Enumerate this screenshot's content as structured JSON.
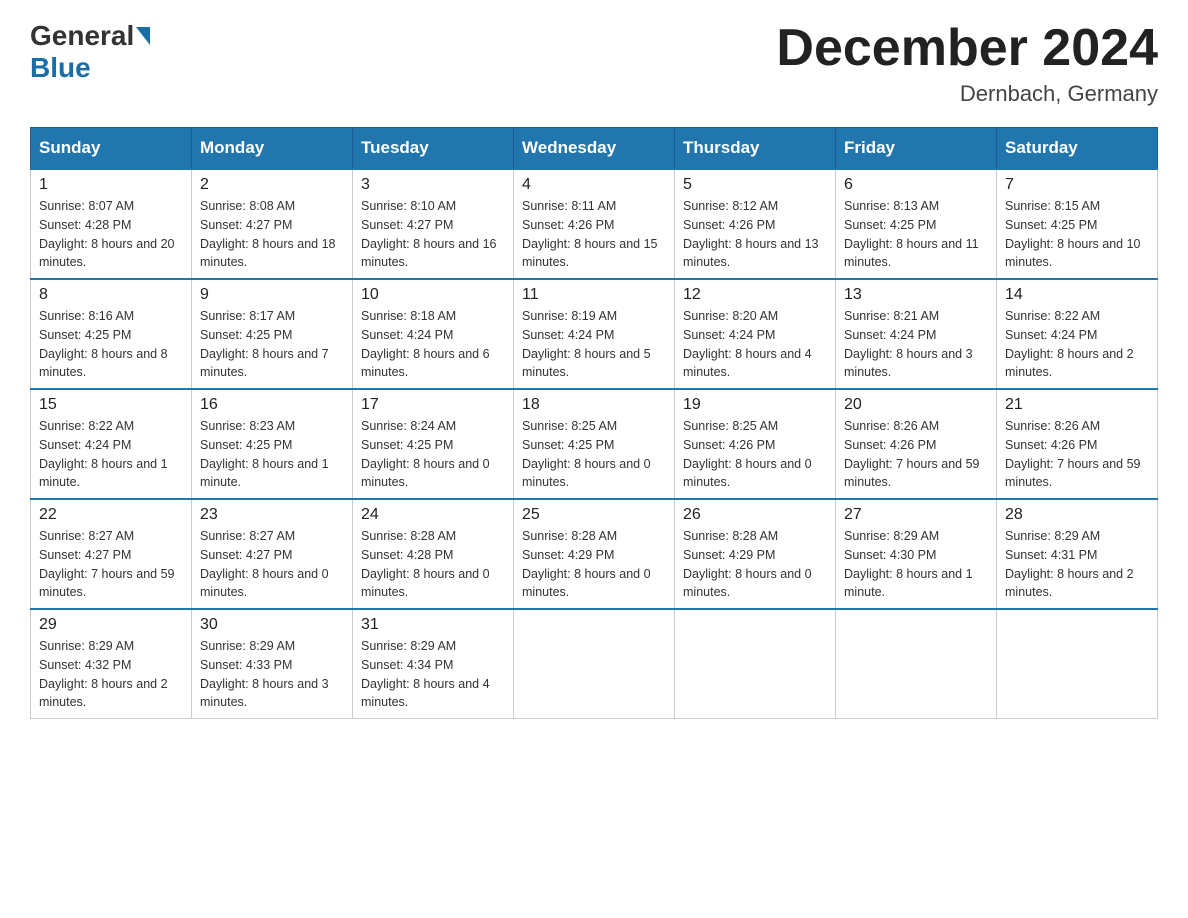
{
  "header": {
    "logo_general": "General",
    "logo_blue": "Blue",
    "title": "December 2024",
    "location": "Dernbach, Germany"
  },
  "days_of_week": [
    "Sunday",
    "Monday",
    "Tuesday",
    "Wednesday",
    "Thursday",
    "Friday",
    "Saturday"
  ],
  "weeks": [
    [
      {
        "day": "1",
        "sunrise": "8:07 AM",
        "sunset": "4:28 PM",
        "daylight": "8 hours and 20 minutes."
      },
      {
        "day": "2",
        "sunrise": "8:08 AM",
        "sunset": "4:27 PM",
        "daylight": "8 hours and 18 minutes."
      },
      {
        "day": "3",
        "sunrise": "8:10 AM",
        "sunset": "4:27 PM",
        "daylight": "8 hours and 16 minutes."
      },
      {
        "day": "4",
        "sunrise": "8:11 AM",
        "sunset": "4:26 PM",
        "daylight": "8 hours and 15 minutes."
      },
      {
        "day": "5",
        "sunrise": "8:12 AM",
        "sunset": "4:26 PM",
        "daylight": "8 hours and 13 minutes."
      },
      {
        "day": "6",
        "sunrise": "8:13 AM",
        "sunset": "4:25 PM",
        "daylight": "8 hours and 11 minutes."
      },
      {
        "day": "7",
        "sunrise": "8:15 AM",
        "sunset": "4:25 PM",
        "daylight": "8 hours and 10 minutes."
      }
    ],
    [
      {
        "day": "8",
        "sunrise": "8:16 AM",
        "sunset": "4:25 PM",
        "daylight": "8 hours and 8 minutes."
      },
      {
        "day": "9",
        "sunrise": "8:17 AM",
        "sunset": "4:25 PM",
        "daylight": "8 hours and 7 minutes."
      },
      {
        "day": "10",
        "sunrise": "8:18 AM",
        "sunset": "4:24 PM",
        "daylight": "8 hours and 6 minutes."
      },
      {
        "day": "11",
        "sunrise": "8:19 AM",
        "sunset": "4:24 PM",
        "daylight": "8 hours and 5 minutes."
      },
      {
        "day": "12",
        "sunrise": "8:20 AM",
        "sunset": "4:24 PM",
        "daylight": "8 hours and 4 minutes."
      },
      {
        "day": "13",
        "sunrise": "8:21 AM",
        "sunset": "4:24 PM",
        "daylight": "8 hours and 3 minutes."
      },
      {
        "day": "14",
        "sunrise": "8:22 AM",
        "sunset": "4:24 PM",
        "daylight": "8 hours and 2 minutes."
      }
    ],
    [
      {
        "day": "15",
        "sunrise": "8:22 AM",
        "sunset": "4:24 PM",
        "daylight": "8 hours and 1 minute."
      },
      {
        "day": "16",
        "sunrise": "8:23 AM",
        "sunset": "4:25 PM",
        "daylight": "8 hours and 1 minute."
      },
      {
        "day": "17",
        "sunrise": "8:24 AM",
        "sunset": "4:25 PM",
        "daylight": "8 hours and 0 minutes."
      },
      {
        "day": "18",
        "sunrise": "8:25 AM",
        "sunset": "4:25 PM",
        "daylight": "8 hours and 0 minutes."
      },
      {
        "day": "19",
        "sunrise": "8:25 AM",
        "sunset": "4:26 PM",
        "daylight": "8 hours and 0 minutes."
      },
      {
        "day": "20",
        "sunrise": "8:26 AM",
        "sunset": "4:26 PM",
        "daylight": "7 hours and 59 minutes."
      },
      {
        "day": "21",
        "sunrise": "8:26 AM",
        "sunset": "4:26 PM",
        "daylight": "7 hours and 59 minutes."
      }
    ],
    [
      {
        "day": "22",
        "sunrise": "8:27 AM",
        "sunset": "4:27 PM",
        "daylight": "7 hours and 59 minutes."
      },
      {
        "day": "23",
        "sunrise": "8:27 AM",
        "sunset": "4:27 PM",
        "daylight": "8 hours and 0 minutes."
      },
      {
        "day": "24",
        "sunrise": "8:28 AM",
        "sunset": "4:28 PM",
        "daylight": "8 hours and 0 minutes."
      },
      {
        "day": "25",
        "sunrise": "8:28 AM",
        "sunset": "4:29 PM",
        "daylight": "8 hours and 0 minutes."
      },
      {
        "day": "26",
        "sunrise": "8:28 AM",
        "sunset": "4:29 PM",
        "daylight": "8 hours and 0 minutes."
      },
      {
        "day": "27",
        "sunrise": "8:29 AM",
        "sunset": "4:30 PM",
        "daylight": "8 hours and 1 minute."
      },
      {
        "day": "28",
        "sunrise": "8:29 AM",
        "sunset": "4:31 PM",
        "daylight": "8 hours and 2 minutes."
      }
    ],
    [
      {
        "day": "29",
        "sunrise": "8:29 AM",
        "sunset": "4:32 PM",
        "daylight": "8 hours and 2 minutes."
      },
      {
        "day": "30",
        "sunrise": "8:29 AM",
        "sunset": "4:33 PM",
        "daylight": "8 hours and 3 minutes."
      },
      {
        "day": "31",
        "sunrise": "8:29 AM",
        "sunset": "4:34 PM",
        "daylight": "8 hours and 4 minutes."
      },
      null,
      null,
      null,
      null
    ]
  ],
  "labels": {
    "sunrise": "Sunrise:",
    "sunset": "Sunset:",
    "daylight": "Daylight:"
  }
}
